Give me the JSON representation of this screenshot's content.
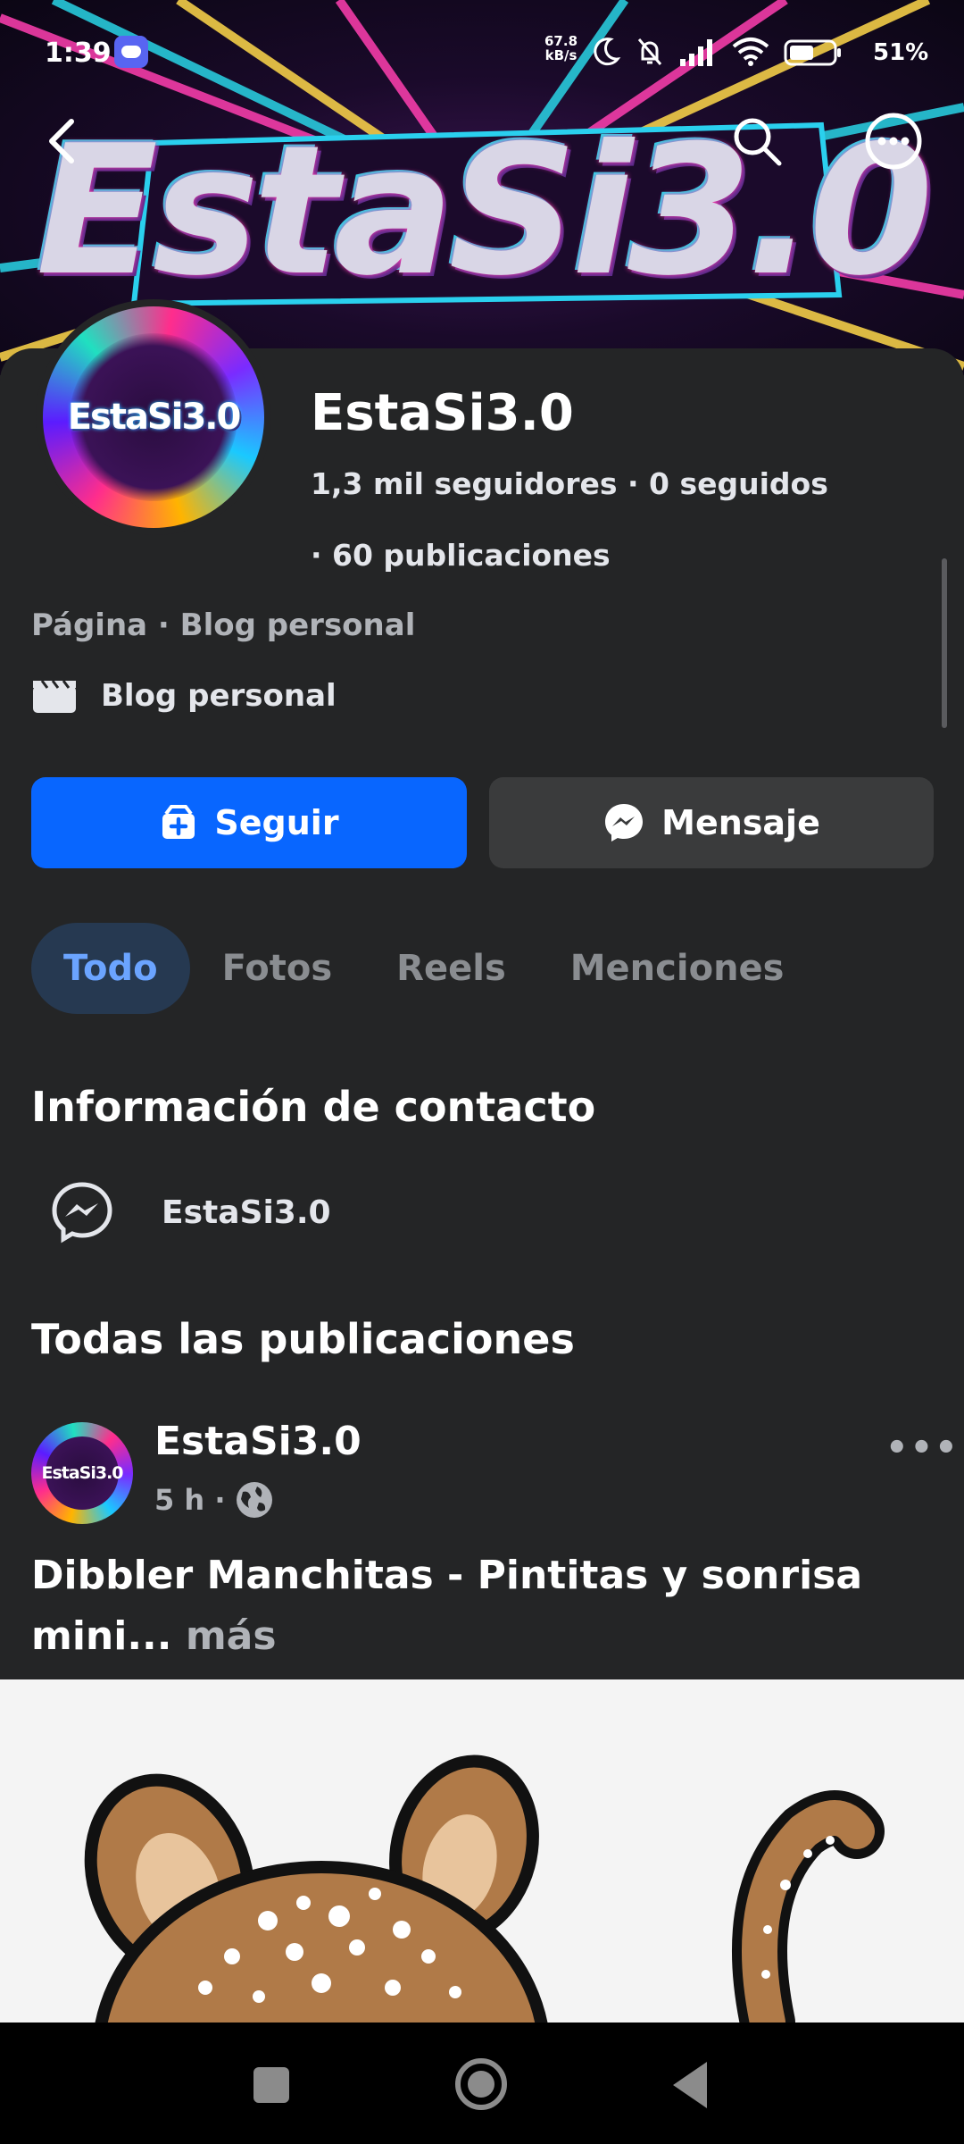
{
  "status_bar": {
    "time": "1:39",
    "net_speed_value": "67.8",
    "net_speed_unit": "kB/s",
    "battery_percent": "51%"
  },
  "cover": {
    "title": "EstaSi3.0"
  },
  "profile": {
    "avatar_label": "EstaSi3.0",
    "name": "EstaSi3.0",
    "stats_line1": "1,3 mil seguidores · 0 seguidos",
    "stats_line2": "· 60 publicaciones",
    "category_line": "Página · Blog personal",
    "blog_label": "Blog personal"
  },
  "actions": {
    "follow_label": "Seguir",
    "message_label": "Mensaje"
  },
  "tabs": [
    {
      "label": "Todo",
      "active": true
    },
    {
      "label": "Fotos",
      "active": false
    },
    {
      "label": "Reels",
      "active": false
    },
    {
      "label": "Menciones",
      "active": false
    }
  ],
  "contact": {
    "title": "Información de contacto",
    "messenger_name": "EstaSi3.0"
  },
  "posts": {
    "title": "Todas las publicaciones",
    "items": [
      {
        "avatar_label": "EstaSi3.0",
        "author": "EstaSi3.0",
        "time": "5 h ·",
        "text": "Dibbler Manchitas - Pintitas y sonrisa mini...",
        "more_label": "más"
      }
    ]
  },
  "colors": {
    "accent": "#0866ff",
    "background": "#242526",
    "tab_active_bg": "#263951",
    "tab_active_text": "#6ba4ff"
  }
}
